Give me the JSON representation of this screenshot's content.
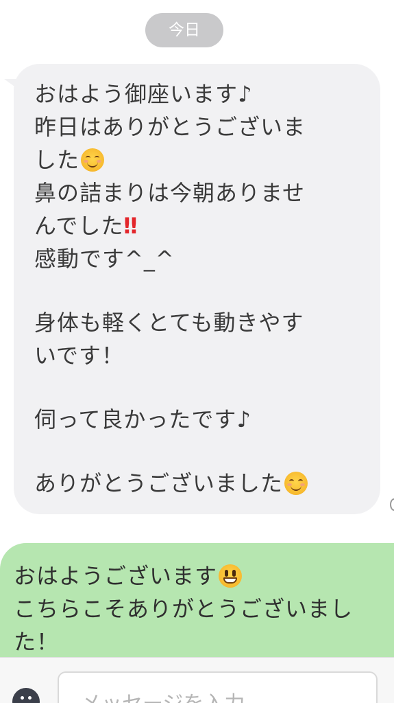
{
  "date_label": "今日",
  "incoming": {
    "lines": [
      {
        "text": "おはよう御座います♪"
      },
      {
        "text": "昨日はありがとうございま"
      },
      {
        "text": "した",
        "emoji": "smiling-face-icon"
      },
      {
        "text": "鼻の詰まりは今朝ありませ"
      },
      {
        "text": "んでした",
        "suffix": "‼"
      },
      {
        "text": "感動です^_^"
      },
      {
        "text": ""
      },
      {
        "text": "身体も軽くとても動きやす"
      },
      {
        "text": "いです！"
      },
      {
        "text": ""
      },
      {
        "text": "伺って良かったです♪"
      },
      {
        "text": ""
      },
      {
        "text": "ありがとうございました",
        "emoji": "smiling-face-icon"
      }
    ]
  },
  "outgoing": {
    "lines": [
      {
        "text": "おはようございます",
        "emoji": "grinning-face-icon"
      },
      {
        "text": "こちらこそありがとうございまし"
      },
      {
        "text": "た！"
      }
    ]
  },
  "input": {
    "placeholder": "メッセージを入力"
  },
  "colors": {
    "incoming_bubble": "#f1f1f3",
    "outgoing_bubble": "#b6e6b0",
    "date_pill": "#c9c9cb",
    "emphasis": "#e3262b"
  }
}
